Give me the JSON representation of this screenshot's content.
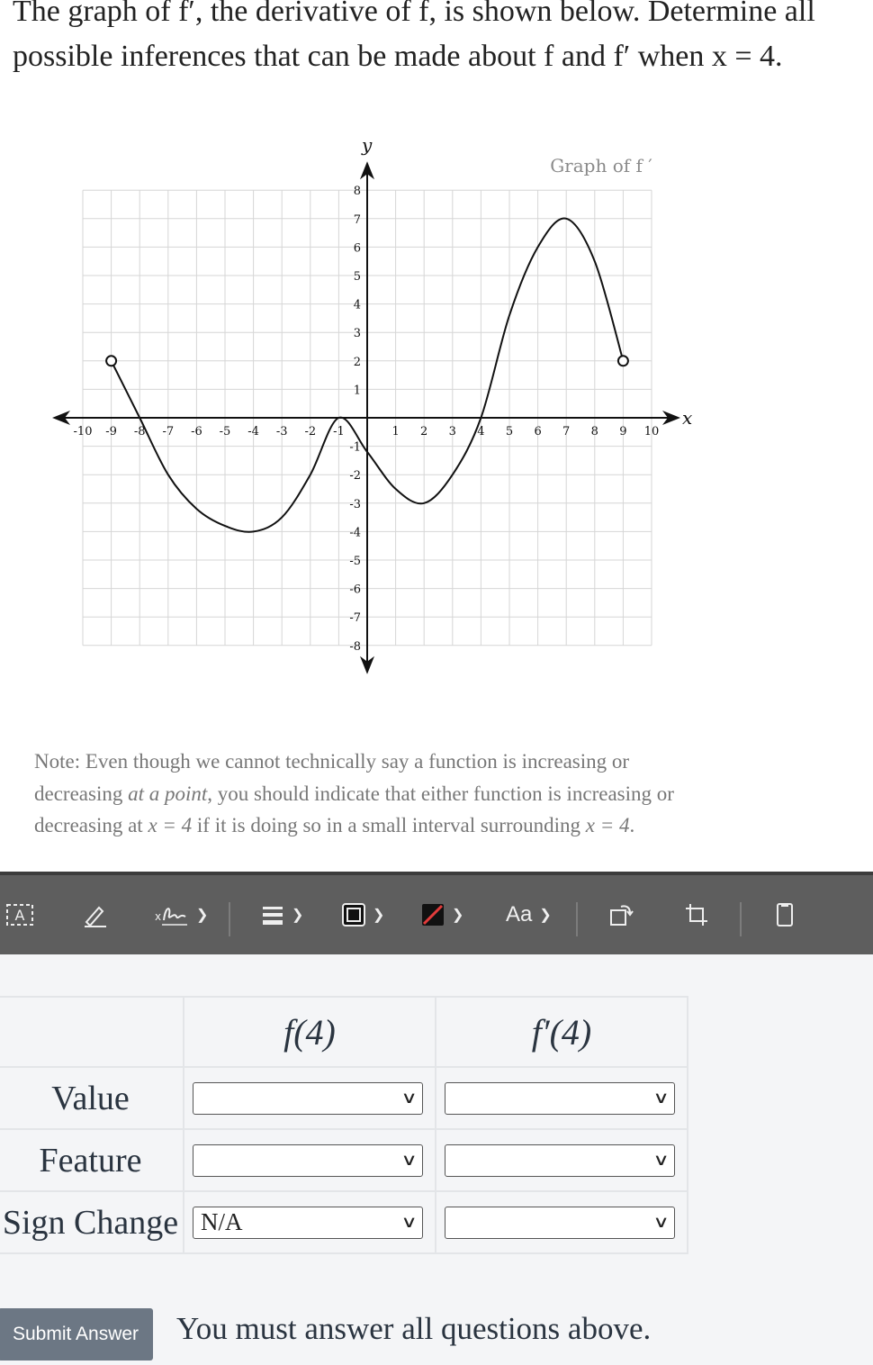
{
  "question": {
    "line1": "The graph of f′, the derivative of f, is shown below. Determine all",
    "line2": "possible inferences that can be made about f and f′ when x = 4."
  },
  "graph": {
    "title": "Graph of f ′",
    "x_axis_label": "x",
    "y_axis_label": "y"
  },
  "chart_data": {
    "type": "line",
    "title": "Graph of f ′",
    "xlabel": "x",
    "ylabel": "y",
    "xlim": [
      -10,
      10
    ],
    "ylim": [
      -8,
      8
    ],
    "grid": true,
    "x_ticks": [
      "-10",
      "-9",
      "-8",
      "-7",
      "-6",
      "-5",
      "-4",
      "-3",
      "-2",
      "-1",
      "1",
      "2",
      "3",
      "4",
      "5",
      "6",
      "7",
      "8",
      "9",
      "10"
    ],
    "y_ticks": [
      "8",
      "7",
      "6",
      "5",
      "4",
      "3",
      "2",
      "1",
      "-1",
      "-2",
      "-3",
      "-4",
      "-5",
      "-6",
      "-7",
      "-8"
    ],
    "series": [
      {
        "x": [
          -9,
          -8,
          -7,
          -6,
          -5,
          -4,
          -3,
          -2,
          -1,
          0,
          1,
          2,
          3,
          4,
          5,
          6,
          7,
          8,
          9
        ],
        "y": [
          2,
          0,
          -2,
          -3.2,
          -3.8,
          -4,
          -3.5,
          -2,
          0,
          -1.2,
          -2.5,
          -3,
          -2,
          0,
          3.6,
          6,
          7,
          5.5,
          2
        ]
      }
    ],
    "open_points": [
      [
        -9,
        2
      ],
      [
        9,
        2
      ]
    ]
  },
  "note": {
    "prefix": "Note: Even though we cannot technically say a function is increasing or decreasing ",
    "emph": "at a point",
    "mid": ", you should indicate that either function is increasing or decreasing at ",
    "x_eq_1": "x = 4",
    "mid2": " if it is doing so in a small interval surrounding ",
    "x_eq_2": "x = 4",
    "end": "."
  },
  "toolbar": {
    "items": [
      "text-box-icon",
      "pencil-icon",
      "signature-icon",
      "line-weight-icon",
      "border-color-icon",
      "fill-color-icon",
      "text-style-icon",
      "rotate-icon",
      "crop-icon",
      "page-icon"
    ],
    "text_style_label": "Aa"
  },
  "answer_table": {
    "col_headers": [
      "f(4)",
      "f′(4)"
    ],
    "rows": [
      {
        "label": "Value",
        "f_value": "",
        "fprime_value": ""
      },
      {
        "label": "Feature",
        "f_value": "",
        "fprime_value": ""
      },
      {
        "label": "Sign Change",
        "f_value": "N/A",
        "fprime_value": ""
      }
    ]
  },
  "submit_label": "Submit Answer",
  "status_message": "You must answer all questions above."
}
